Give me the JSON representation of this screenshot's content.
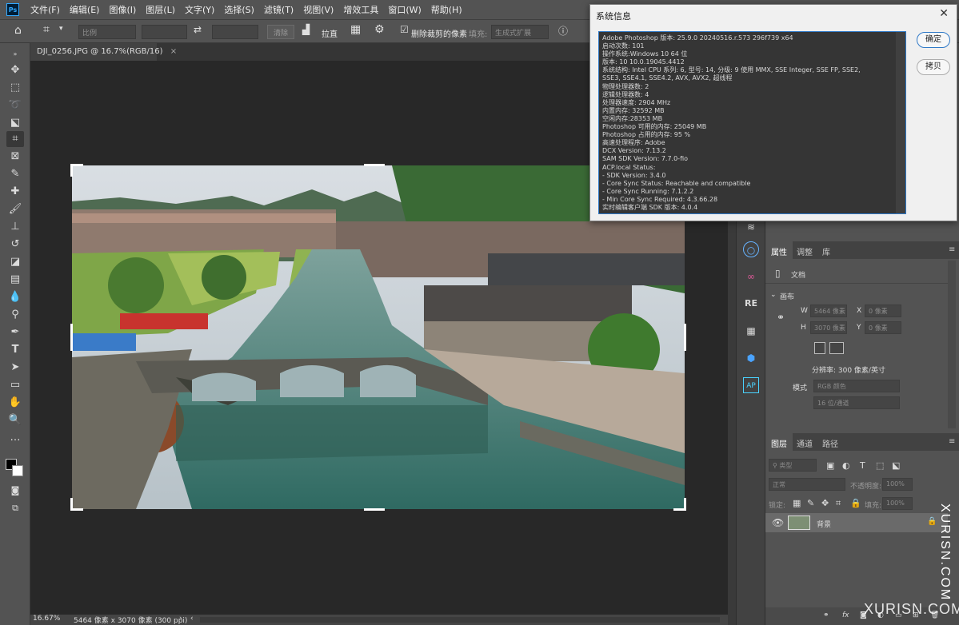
{
  "app": {
    "logo": "Ps",
    "menus": [
      "文件(F)",
      "编辑(E)",
      "图像(I)",
      "图层(L)",
      "文字(Y)",
      "选择(S)",
      "滤镜(T)",
      "视图(V)",
      "增效工具",
      "窗口(W)",
      "帮助(H)"
    ]
  },
  "options": {
    "ratio_placeholder": "比例",
    "clear_label": "清除",
    "straighten_label": "拉直",
    "delete_cropped_label": "删除裁剪的像素",
    "delete_cropped_checked": true,
    "fill_label": "填充:",
    "fill_value": "生成式扩展"
  },
  "document": {
    "tab_title": "DJI_0256.JPG @ 16.7%(RGB/16)",
    "zoom": "16.67%",
    "dims": "5464 像素 x 3070 像素 (300 ppi)"
  },
  "dialog": {
    "title": "系统信息",
    "ok_label": "确定",
    "copy_label": "拷贝",
    "info_lines": [
      "Adobe Photoshop 版本: 25.9.0 20240516.r.573 296f739  x64",
      "启动次数: 101",
      "操作系统:Windows 10 64 位",
      "版本: 10 10.0.19045.4412",
      "系统结构: Intel CPU 系列: 6, 型号: 14, 分级: 9 使用 MMX, SSE Integer, SSE FP, SSE2,",
      "SSE3, SSE4.1, SSE4.2, AVX, AVX2, 超线程",
      "物理处理器数: 2",
      "逻辑处理器数: 4",
      "处理器速度: 2904 MHz",
      "内置内存: 32592 MB",
      "空闲内存:28353 MB",
      "Photoshop 可用的内存: 25049 MB",
      "Photoshop 占用的内存: 95 %",
      "高速处理程序: Adobe",
      "DCX Version: 7.13.2",
      "SAM SDK Version: 7.7.0-fio",
      "ACP.local Status:",
      " - SDK Version: 3.4.0",
      " - Core Sync Status: Reachable and compatible",
      " - Core Sync Running: 7.1.2.2",
      " - Min Core Sync Required: 4.3.66.28",
      "实时编辑客户端 SDK 版本: 4.0.4"
    ]
  },
  "properties": {
    "tabs": [
      "属性",
      "调整",
      "库"
    ],
    "doc_label": "文档",
    "canvas_label": "画布",
    "w_label": "W",
    "w_value": "5464 像素",
    "h_label": "H",
    "h_value": "3070 像素",
    "x_label": "X",
    "x_value": "0 像素",
    "y_label": "Y",
    "y_value": "0 像素",
    "resolution": "分辨率: 300 像素/英寸",
    "mode_label": "模式",
    "mode_value": "RGB 颜色",
    "depth_value": "16 位/通道"
  },
  "layers": {
    "tabs": [
      "图层",
      "通道",
      "路径"
    ],
    "filter_label": "类型",
    "blend_mode": "正常",
    "opacity_label": "不透明度:",
    "opacity_value": "100%",
    "lock_label": "锁定:",
    "fill_label": "填充:",
    "fill_value": "100%",
    "layer_name": "背景"
  },
  "watermark": {
    "vertical": "XURISN.COM",
    "horizontal": "XURISN.COM"
  }
}
